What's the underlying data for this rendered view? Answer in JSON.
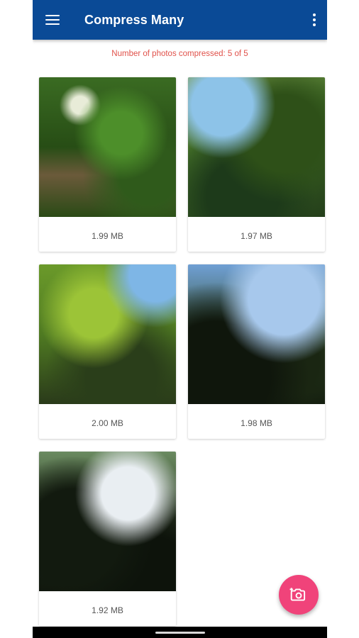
{
  "app_bar": {
    "title": "Compress Many",
    "menu_icon": "hamburger-menu-icon",
    "overflow_icon": "more-vert-icon",
    "background_color": "#0a4a96"
  },
  "status": {
    "text": "Number of photos compressed: 5 of 5",
    "color": "#e0514a"
  },
  "photos": [
    {
      "size": "1.99 MB"
    },
    {
      "size": "1.97 MB"
    },
    {
      "size": "2.00 MB"
    },
    {
      "size": "1.98 MB"
    },
    {
      "size": "1.92 MB"
    }
  ],
  "fab": {
    "icon": "add-photo-camera-icon",
    "color": "#f0437a"
  }
}
